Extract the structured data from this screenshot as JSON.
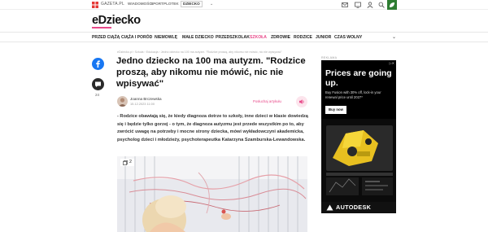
{
  "topbar": {
    "portal_name": "GAZETA.PL",
    "links": [
      "WIADOMOŚCI",
      "SPORT",
      "PLOTEK",
      "DZIECKO"
    ],
    "active_link": "DZIECKO"
  },
  "brand": {
    "name": "eDziecko",
    "accent_color": "#e84a8a"
  },
  "nav": {
    "items": [
      "PRZED CIĄŻĄ",
      "CIĄŻA I PORÓD",
      "NIEMOWLĘ",
      "MAŁE DZIECKO",
      "PRZEDSZKOLAK",
      "SZKOŁA",
      "ZDROWIE",
      "RODZICE",
      "JUNIOR",
      "CZAS WOLNY"
    ],
    "active": "SZKOŁA"
  },
  "social": {
    "comment_count": "24"
  },
  "article": {
    "breadcrumb": "eDziecko.pl › Szkoła › Edukacja › Jedno dziecko na 100 ma autyzm. \"Rodzice proszą, aby nikomu nie mówić, nic nie wpisywać\"",
    "title": "Jedno dziecko na 100 ma autyzm. \"Rodzice proszą, aby nikomu nie mówić, nic nie wpisywać\"",
    "author": "Joanna Brczewska",
    "date": "15.12.2023 11:00",
    "listen_label": "Posłuchaj artykułu",
    "lead": "- Rodzice obawiają się, że kiedy diagnoza dotrze to szkoły, inne dzieci w klasie dowiedzą się i będzie tylko gorzej - o tym, że diagnoza autyzmu jest przede wszystkim po to, aby zwrócić uwagę na potrzeby i mocne strony dziecka, mówi wykładowczyni akademicka, psycholog dzieci i młodzieży, psychoterapeutka Katarzyna Szamburska-Lewandowska.",
    "gallery_count": "2"
  },
  "ad": {
    "label": "REKLAMA",
    "headline": "Prices are going up.",
    "subtext": "Buy Fusion with 30% off, lock-in your renewal price until 2027*",
    "cta": "Buy now",
    "brand": "AUTODESK"
  }
}
